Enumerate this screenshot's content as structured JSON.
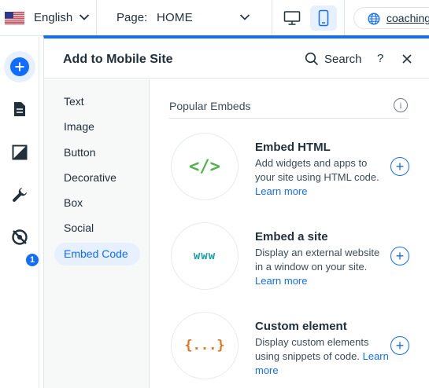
{
  "topbar": {
    "language": "English",
    "page_prefix": "Page:",
    "page_value": "HOME",
    "site_name": "coaching"
  },
  "rail": {
    "badge_count": "1"
  },
  "panel": {
    "title": "Add to Mobile Site",
    "search_label": "Search",
    "help_label": "?",
    "categories": [
      "Text",
      "Image",
      "Button",
      "Decorative",
      "Box",
      "Social",
      "Embed Code"
    ],
    "selected_category": "Embed Code",
    "section_title": "Popular Embeds",
    "info_glyph": "i",
    "items": [
      {
        "title": "Embed HTML",
        "desc": "Add widgets and apps to your site using HTML code.",
        "learn": "Learn more",
        "icon_text": "</>",
        "icon_color": "#4eb547"
      },
      {
        "title": "Embed a site",
        "desc": "Display an external website in a window on your site.",
        "learn": "Learn more",
        "icon_text": "www",
        "icon_color": "#16a3a3"
      },
      {
        "title": "Custom element",
        "desc": "Display custom elements using snippets of code.",
        "learn": "Learn more",
        "icon_text": "{...}",
        "icon_color": "#e8761f"
      }
    ],
    "add_glyph": "+"
  },
  "colors": {
    "accent": "#116dff",
    "accent_light": "#e7f0ff"
  }
}
